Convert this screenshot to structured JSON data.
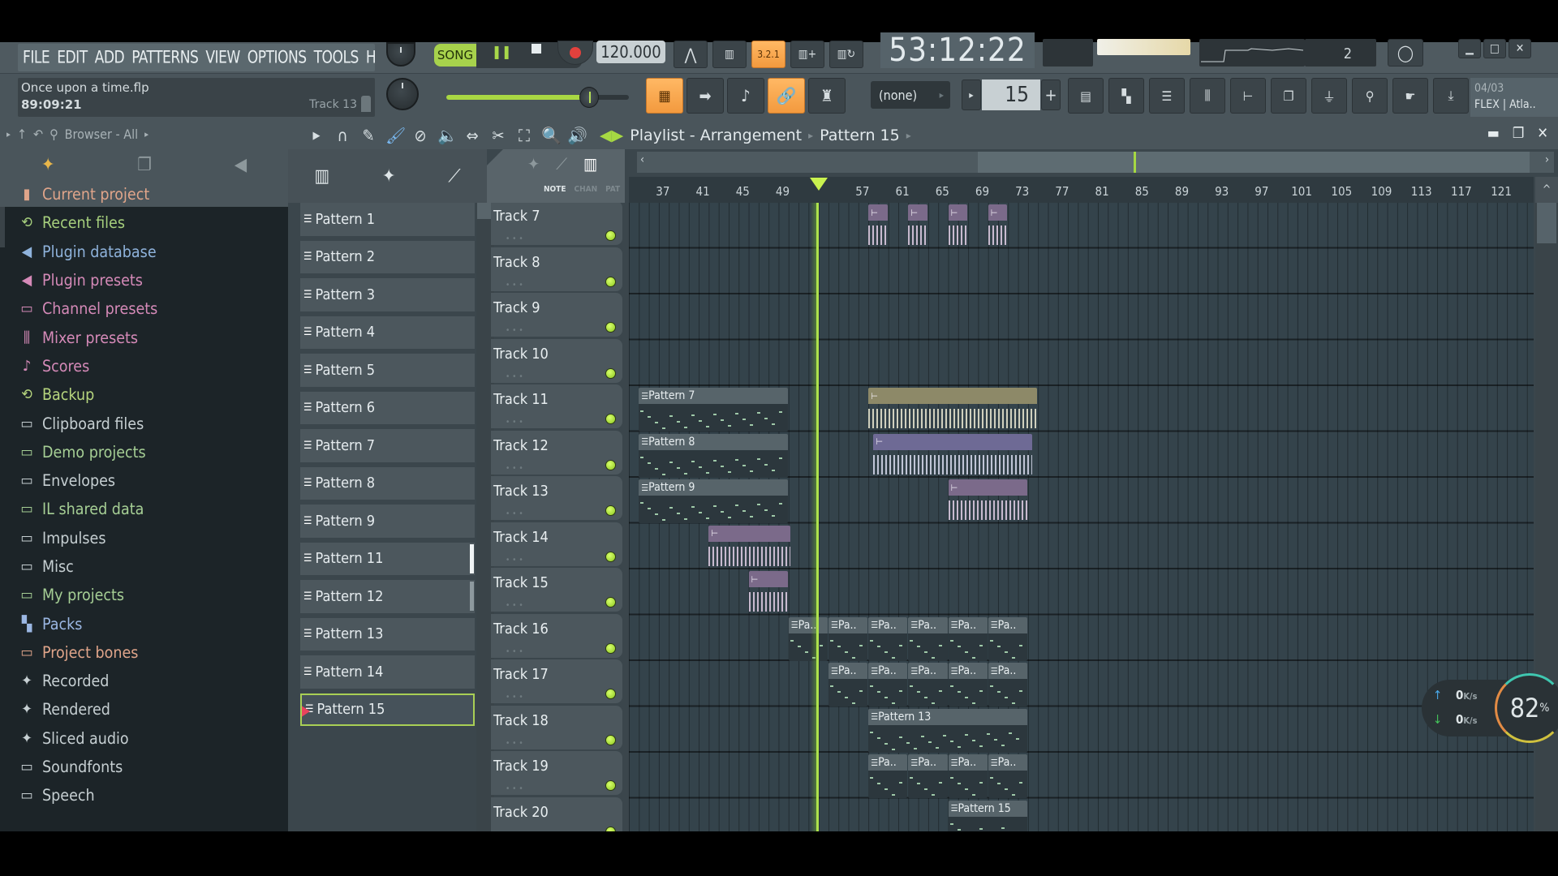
{
  "menu": [
    "FILE",
    "EDIT",
    "ADD",
    "PATTERNS",
    "VIEW",
    "OPTIONS",
    "TOOLS",
    "HELP"
  ],
  "hint_bar": {
    "file": "Once upon a time.flp",
    "time": "89:09:21",
    "track": "Track 13"
  },
  "transport": {
    "mode": "SONG",
    "tempo": "120.000",
    "song_time": "53:12:22",
    "cpu_cores": "2"
  },
  "toolbar": {
    "snap": "(none)",
    "pattern_number": "15",
    "news": "04/03",
    "news_text": "FLEX | Atla.."
  },
  "master_volume": 0.78,
  "browser": {
    "title": "Browser - All",
    "items": [
      {
        "label": "Current project",
        "icon": "project-icon",
        "color": "#e0a58a"
      },
      {
        "label": "Recent files",
        "icon": "recent-folder-icon",
        "color": "#a6cf7d"
      },
      {
        "label": "Plugin database",
        "icon": "plugin-icon",
        "color": "#8fb3dc"
      },
      {
        "label": "Plugin presets",
        "icon": "plugin-icon",
        "color": "#d58ab8"
      },
      {
        "label": "Channel presets",
        "icon": "channel-icon",
        "color": "#d58ab8"
      },
      {
        "label": "Mixer presets",
        "icon": "mixer-icon",
        "color": "#d58ab8"
      },
      {
        "label": "Scores",
        "icon": "note-icon",
        "color": "#d58ab8"
      },
      {
        "label": "Backup",
        "icon": "recent-folder-icon",
        "color": "#b7d67e"
      },
      {
        "label": "Clipboard files",
        "icon": "folder-plus-icon",
        "color": "#c6cfd2"
      },
      {
        "label": "Demo projects",
        "icon": "folder-plus-icon",
        "color": "#a6cf95"
      },
      {
        "label": "Envelopes",
        "icon": "folder-icon",
        "color": "#c6cfd2"
      },
      {
        "label": "IL shared data",
        "icon": "folder-plus-icon",
        "color": "#a6cf95"
      },
      {
        "label": "Impulses",
        "icon": "folder-icon",
        "color": "#c6cfd2"
      },
      {
        "label": "Misc",
        "icon": "folder-icon",
        "color": "#c6cfd2"
      },
      {
        "label": "My projects",
        "icon": "folder-plus-icon",
        "color": "#a6cf95"
      },
      {
        "label": "Packs",
        "icon": "packs-icon",
        "color": "#9bb7e3"
      },
      {
        "label": "Project bones",
        "icon": "folder-plus-icon",
        "color": "#e0a58a"
      },
      {
        "label": "Recorded",
        "icon": "wave-icon",
        "color": "#c6cfd2"
      },
      {
        "label": "Rendered",
        "icon": "wave-render-icon",
        "color": "#c6cfd2"
      },
      {
        "label": "Sliced audio",
        "icon": "wave-icon",
        "color": "#c6cfd2"
      },
      {
        "label": "Soundfonts",
        "icon": "folder-icon",
        "color": "#c6cfd2"
      },
      {
        "label": "Speech",
        "icon": "folder-plus-icon",
        "color": "#c6cfd2"
      }
    ]
  },
  "playlist": {
    "title": "Playlist - Arrangement",
    "current_pattern": "Pattern 15",
    "tab_labels": [
      "NOTE",
      "CHAN",
      "PAT"
    ],
    "ruler": [
      "37",
      "41",
      "45",
      "49",
      "53",
      "57",
      "61",
      "65",
      "69",
      "73",
      "77",
      "81",
      "85",
      "89",
      "93",
      "97",
      "101",
      "105",
      "109",
      "113",
      "117",
      "121"
    ],
    "first_bar": 34,
    "playhead_bar": 53,
    "patterns": [
      "Pattern 1",
      "Pattern 2",
      "Pattern 3",
      "Pattern 4",
      "Pattern 5",
      "Pattern 6",
      "Pattern 7",
      "Pattern 8",
      "Pattern 9",
      "Pattern 11",
      "Pattern 12",
      "Pattern 13",
      "Pattern 14",
      "Pattern 15"
    ],
    "selected_pattern": "Pattern 15",
    "tracks": [
      "Track 7",
      "Track 8",
      "Track 9",
      "Track 10",
      "Track 11",
      "Track 12",
      "Track 13",
      "Track 14",
      "Track 15",
      "Track 16",
      "Track 17",
      "Track 18",
      "Track 19",
      "Track 20"
    ],
    "clips": [
      {
        "track": 0,
        "start": 58,
        "len": 2,
        "type": "aud1",
        "label": ""
      },
      {
        "track": 0,
        "start": 62,
        "len": 2,
        "type": "aud1",
        "label": ""
      },
      {
        "track": 0,
        "start": 66,
        "len": 2,
        "type": "aud1",
        "label": ""
      },
      {
        "track": 0,
        "start": 70,
        "len": 2,
        "type": "aud1",
        "label": ""
      },
      {
        "track": 4,
        "start": 35,
        "len": 15,
        "type": "pat",
        "label": "Pattern 7"
      },
      {
        "track": 4,
        "start": 58,
        "len": 17,
        "type": "aud2",
        "label": ""
      },
      {
        "track": 5,
        "start": 35,
        "len": 15,
        "type": "pat",
        "label": "Pattern 8"
      },
      {
        "track": 5,
        "start": 58.5,
        "len": 16,
        "type": "aud3",
        "label": ""
      },
      {
        "track": 6,
        "start": 35,
        "len": 15,
        "type": "pat",
        "label": "Pattern 9"
      },
      {
        "track": 6,
        "start": 66,
        "len": 8,
        "type": "aud1",
        "label": ""
      },
      {
        "track": 7,
        "start": 42,
        "len": 8.3,
        "type": "aud1",
        "label": ""
      },
      {
        "track": 8,
        "start": 46,
        "len": 4,
        "type": "aud1",
        "label": ""
      },
      {
        "track": 9,
        "start": 50,
        "len": 4,
        "type": "pat",
        "label": "Pa.."
      },
      {
        "track": 9,
        "start": 54,
        "len": 4,
        "type": "pat",
        "label": "Pa.."
      },
      {
        "track": 9,
        "start": 58,
        "len": 4,
        "type": "pat",
        "label": "Pa.."
      },
      {
        "track": 9,
        "start": 62,
        "len": 4,
        "type": "pat",
        "label": "Pa.."
      },
      {
        "track": 9,
        "start": 66,
        "len": 4,
        "type": "pat",
        "label": "Pa.."
      },
      {
        "track": 9,
        "start": 70,
        "len": 4,
        "type": "pat",
        "label": "Pa.."
      },
      {
        "track": 10,
        "start": 54,
        "len": 4,
        "type": "pat",
        "label": "Pa.."
      },
      {
        "track": 10,
        "start": 58,
        "len": 4,
        "type": "pat",
        "label": "Pa.."
      },
      {
        "track": 10,
        "start": 62,
        "len": 4,
        "type": "pat",
        "label": "Pa.."
      },
      {
        "track": 10,
        "start": 66,
        "len": 4,
        "type": "pat",
        "label": "Pa.."
      },
      {
        "track": 10,
        "start": 70,
        "len": 4,
        "type": "pat",
        "label": "Pa.."
      },
      {
        "track": 11,
        "start": 58,
        "len": 16,
        "type": "pat",
        "label": "Pattern 13"
      },
      {
        "track": 12,
        "start": 58,
        "len": 4,
        "type": "pat",
        "label": "Pa.."
      },
      {
        "track": 12,
        "start": 62,
        "len": 4,
        "type": "pat",
        "label": "Pa.."
      },
      {
        "track": 12,
        "start": 66,
        "len": 4,
        "type": "pat",
        "label": "Pa.."
      },
      {
        "track": 12,
        "start": 70,
        "len": 4,
        "type": "pat",
        "label": "Pa.."
      },
      {
        "track": 13,
        "start": 66,
        "len": 8,
        "type": "pat",
        "label": "Pattern 15"
      }
    ]
  },
  "status": {
    "upload": "0",
    "download": "0",
    "rate_unit": "K/s",
    "cpu_percent": "82",
    "percent_sign": "%"
  }
}
